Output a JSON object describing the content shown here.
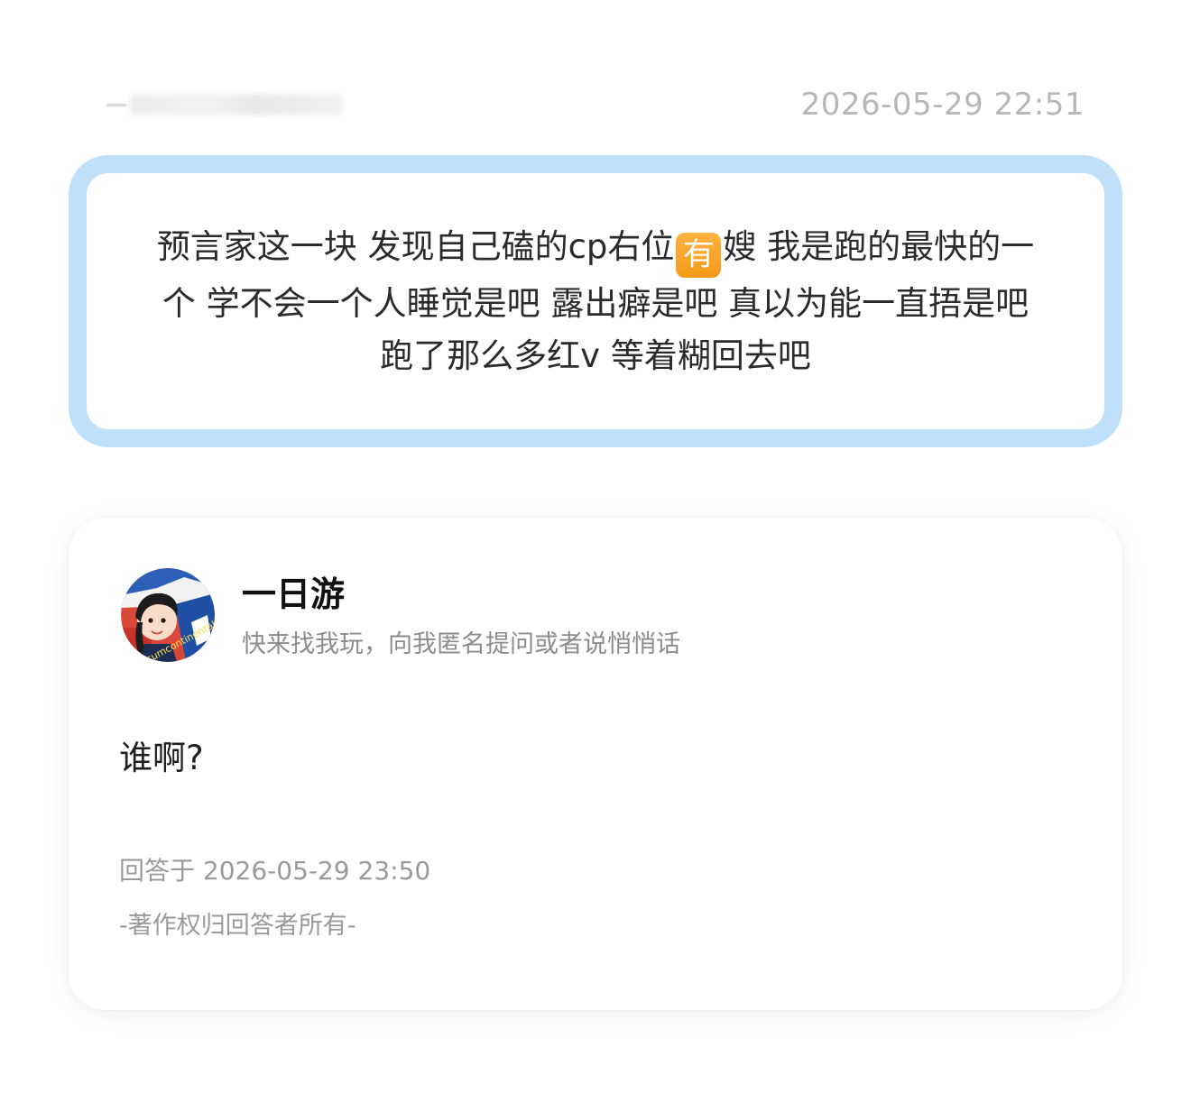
{
  "question": {
    "time": "2026-05-29 22:51",
    "text_before_badge": "预言家这一块 发现自己磕的cp右位",
    "badge": "有",
    "text_after_badge": "嫂 我是跑的最快的一个 学不会一个人睡觉是吧 露出癖是吧 真以为能一直捂是吧 跑了那么多红v 等着糊回去吧"
  },
  "answer": {
    "user_name": "一日游",
    "user_bio": "快来找我玩，向我匿名提问或者说悄悄话",
    "avatar_text": "Circumcontinental",
    "text": "谁啊?",
    "answered_at": "回答于 2026-05-29 23:50",
    "copyright": "-著作权归回答者所有-"
  },
  "colors": {
    "bubble_border": "#bfe0fb",
    "badge": "#f5a21f",
    "muted_text": "#9a9a9a"
  }
}
